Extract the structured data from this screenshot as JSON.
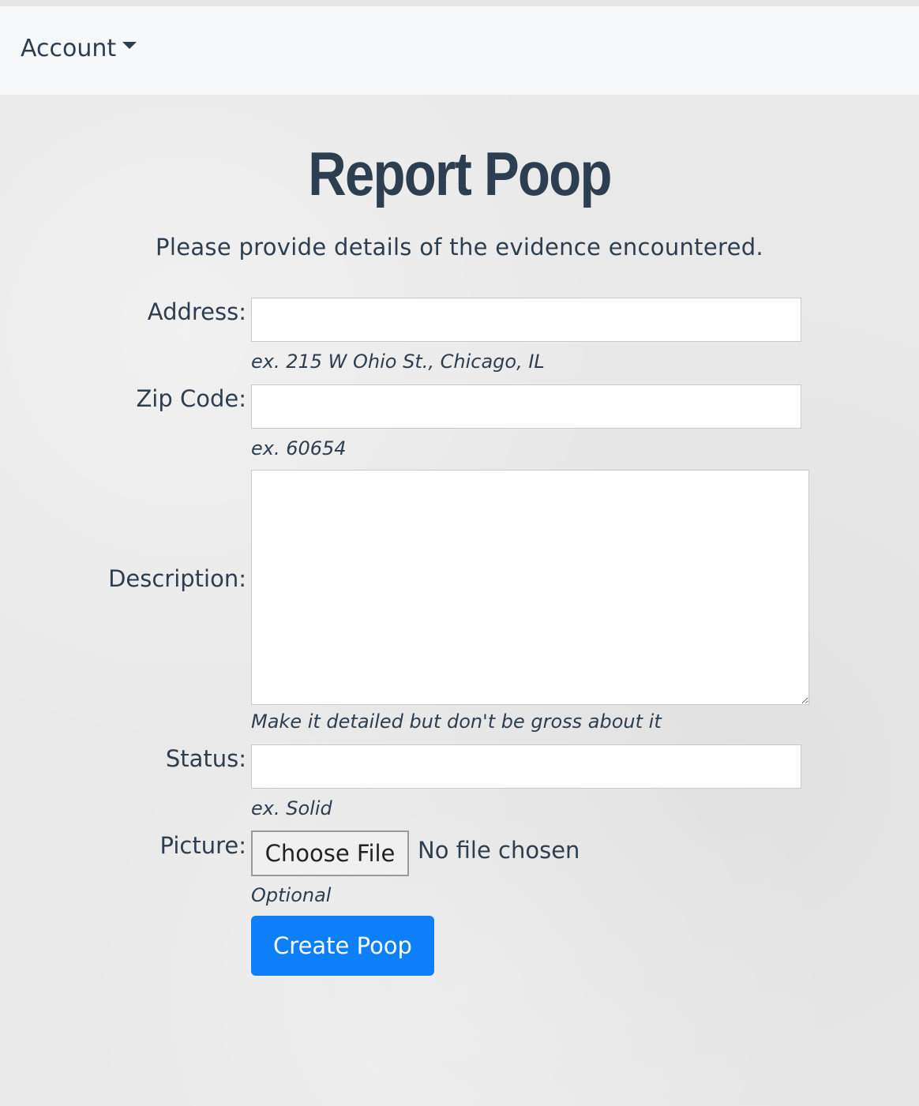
{
  "navbar": {
    "account_label": "Account"
  },
  "page": {
    "title": "Report Poop",
    "subtitle": "Please provide details of the evidence encountered."
  },
  "form": {
    "address": {
      "label": "Address:",
      "value": "",
      "hint": "ex. 215 W Ohio St., Chicago, IL"
    },
    "zip": {
      "label": "Zip Code:",
      "value": "",
      "hint": "ex. 60654"
    },
    "description": {
      "label": "Description:",
      "value": "",
      "hint": "Make it detailed but don't be gross about it"
    },
    "status": {
      "label": "Status:",
      "value": "",
      "hint": "ex. Solid"
    },
    "picture": {
      "label": "Picture:",
      "button_label": "Choose File",
      "file_status": "No file chosen",
      "hint": "Optional"
    },
    "submit_label": "Create Poop"
  },
  "colors": {
    "text": "#2c3e50",
    "navbar_bg": "#f7f8f9",
    "page_bg": "#e9e9e9",
    "primary": "#0d7ff9"
  }
}
